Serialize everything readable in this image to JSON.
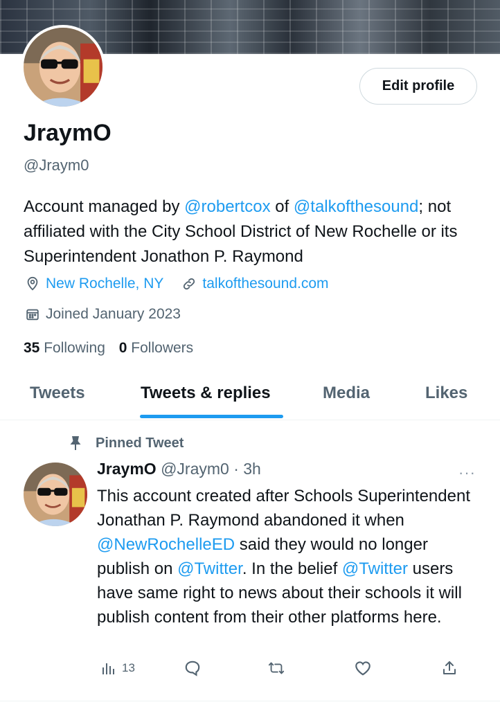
{
  "profile": {
    "name": "JraymO",
    "handle": "@Jraym0",
    "edit_button": "Edit profile",
    "bio": {
      "t1": "Account managed by ",
      "m1": "@robertcox",
      "t2": " of ",
      "m2": "@talkofthesound",
      "t3": "; not affiliated with the City School District of New Rochelle or its Superintendent Jonathon P. Raymond"
    },
    "location": "New Rochelle, NY",
    "website": "talkofthesound.com",
    "joined": "Joined January 2023",
    "following_count": "35",
    "following_label": "Following",
    "followers_count": "0",
    "followers_label": "Followers"
  },
  "tabs": [
    "Tweets",
    "Tweets & replies",
    "Media",
    "Likes"
  ],
  "active_tab": "Tweets & replies",
  "pinned_label": "Pinned Tweet",
  "tweet": {
    "name": "JraymO",
    "handle_time": "@Jraym0 · 3h",
    "more": "···",
    "text": {
      "t1": "This account created after Schools Superintendent Jonathan P. Raymond abandoned it when ",
      "m1": "@NewRochelleED",
      "t2": " said they would no longer publish on ",
      "m2": "@Twitter",
      "t3": ". In the belief ",
      "m3": "@Twitter",
      "t4": " users have same right to news about their schools it will publish content from their other platforms here."
    },
    "views": "13"
  },
  "icons": {
    "location": "location-pin-icon",
    "link": "link-icon",
    "calendar": "calendar-icon",
    "pin": "pin-icon",
    "views": "views-chart-icon",
    "reply": "reply-icon",
    "retweet": "retweet-icon",
    "like": "heart-icon",
    "share": "share-icon"
  },
  "colors": {
    "accent": "#1d9bf0",
    "text": "#0f1419",
    "secondary": "#536471",
    "border": "#cfd9de"
  }
}
